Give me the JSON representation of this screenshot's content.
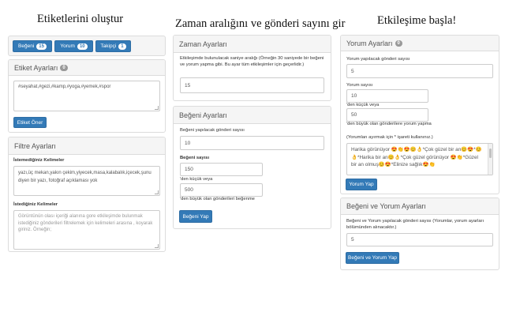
{
  "headings": {
    "col1": "Etiketlerini oluştur",
    "col2": "Zaman aralığını ve gönderi sayını gir",
    "col3": "Etkileşime başla!"
  },
  "tabs": [
    {
      "label": "Beğeni",
      "count": "15"
    },
    {
      "label": "Yorum",
      "count": "10"
    },
    {
      "label": "Takipçi",
      "count": "1"
    }
  ],
  "tag_settings": {
    "title": "Etiket Ayarları",
    "count": "0",
    "tags_value": "#seyahat,#gezi,#kamp,#yoga,#yemek,#spor",
    "suggest_button": "Etiket Öner"
  },
  "filter_settings": {
    "title": "Filtre Ayarları",
    "unwanted_label": "İstemediğiniz Kelimeler",
    "unwanted_value": "yazı,üç mekan,yakın çekim,yiyecek,masa,kalabalık,içecek,şunu diyen bir yazı, fotoğraf açıklaması yok",
    "wanted_label": "İstediğiniz Kelimeler",
    "wanted_placeholder": "Görüntünün olası içeriği alanına gore etkileşimde bulunmak istediğiniz gönderileri filtrelemek için kelimeleri arasına , koyarak giriniz. Örneğin;"
  },
  "time_settings": {
    "title": "Zaman Ayarları",
    "description": "Etkileşimde bulunulacak saniye aralığı (Örneğin 30 saniyede bir beğeni ve yorum yapma gibi. Bu ayar tüm etkileşimler için geçerlidir.)",
    "interval_value": "15"
  },
  "like_settings": {
    "title": "Beğeni Ayarları",
    "post_count_label": "Beğeni yapılacak gönderi sayısı",
    "post_count_value": "10",
    "like_count_label": "Beğeni sayısı",
    "like_count_value": "150",
    "like_count_suffix": "'den küçük veya",
    "max_value": "500",
    "max_suffix": "'den büyük olan gönderileri beğenme",
    "button": "Beğeni Yap"
  },
  "comment_settings": {
    "title": "Yorum Ayarları",
    "count": "0",
    "post_count_label": "Yorum yapılacak gönderi sayısı",
    "post_count_value": "5",
    "comment_count_label": "Yorum sayısı",
    "comment_count_value": "10",
    "comment_count_suffix": "'den küçük veya",
    "max_value": "50",
    "max_suffix": "'den büyük olan gönderilere yorum yapma",
    "comments_label": "(Yorumları ayırmak için * işareti kullanınız.)",
    "comments_value": "Harika görünüyor 😍👏😍😊👌*Çok güzel bir an😊😍*😊👌*Harika bir an😊👌*Çok güzel görünüyor 😍👏*Güzel bir an olmuş😊😍*Elinize sağlık😍👏",
    "button": "Yorum Yap"
  },
  "like_comment_settings": {
    "title": "Beğeni ve Yorum Ayarları",
    "post_count_label": "Beğeni ve Yorum yapılacak gönderi sayısı (Yorumlar, yorum ayarları bölümünden alınacaktır.)",
    "post_count_value": "5",
    "button": "Beğeni ve Yorum Yap"
  }
}
